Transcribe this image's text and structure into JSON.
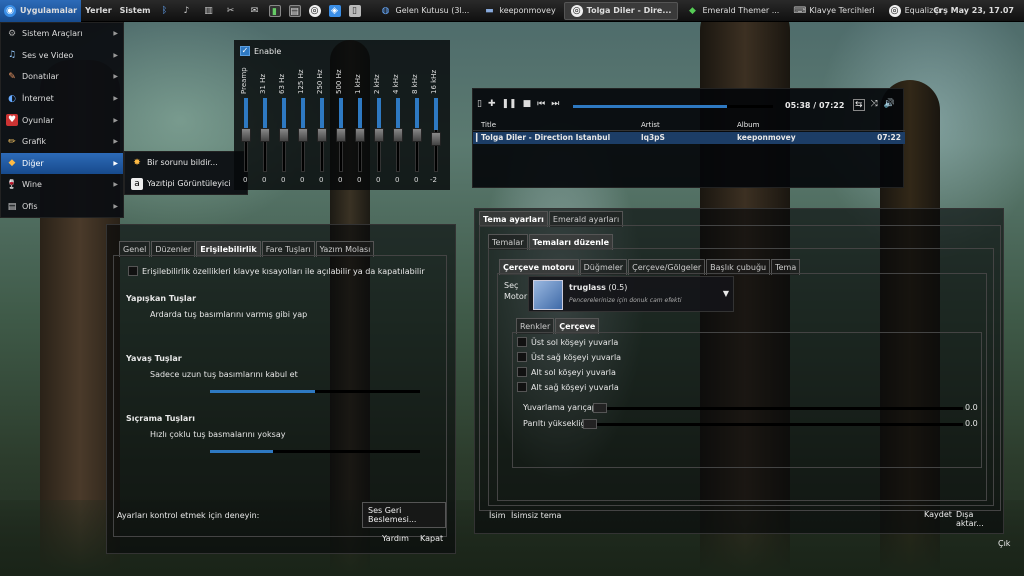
{
  "top_panel": {
    "menus": [
      "Uygulamalar",
      "Yerler",
      "Sistem"
    ],
    "tasks": [
      {
        "label": "Gelen Kutusu (3l...",
        "active": false
      },
      {
        "label": "keeponmovey",
        "active": false
      },
      {
        "label": "Tolga Diler - Dire...",
        "active": true
      },
      {
        "label": "Emerald Themer ...",
        "active": false
      },
      {
        "label": "Klavye Tercihleri",
        "active": false
      },
      {
        "label": "Equalizer",
        "active": false
      }
    ],
    "clock": "Çrş May 23, 17.07"
  },
  "app_menu": {
    "items": [
      {
        "label": "Sistem Araçları",
        "icon": "tools-icon"
      },
      {
        "label": "Ses ve Video",
        "icon": "media-icon"
      },
      {
        "label": "Donatılar",
        "icon": "accessories-icon"
      },
      {
        "label": "İnternet",
        "icon": "internet-icon"
      },
      {
        "label": "Oyunlar",
        "icon": "games-icon"
      },
      {
        "label": "Grafik",
        "icon": "graphics-icon"
      },
      {
        "label": "Diğer",
        "icon": "other-icon"
      },
      {
        "label": "Wine",
        "icon": "wine-icon"
      },
      {
        "label": "Ofis",
        "icon": "office-icon"
      }
    ],
    "highlighted_index": 6,
    "submenu": [
      "Bir sorunu bildir...",
      "Yazıtipi Görüntüleyici"
    ]
  },
  "equalizer": {
    "enable_label": "Enable",
    "enabled": true,
    "bands": [
      {
        "label": "Preamp",
        "value": "0"
      },
      {
        "label": "31 Hz",
        "value": "0"
      },
      {
        "label": "63 Hz",
        "value": "0"
      },
      {
        "label": "125 Hz",
        "value": "0"
      },
      {
        "label": "250 Hz",
        "value": "0"
      },
      {
        "label": "500 Hz",
        "value": "0"
      },
      {
        "label": "1 kHz",
        "value": "0"
      },
      {
        "label": "2 kHz",
        "value": "0"
      },
      {
        "label": "4 kHz",
        "value": "0"
      },
      {
        "label": "8 kHz",
        "value": "0"
      },
      {
        "label": "16 kHz",
        "value": "-2"
      }
    ]
  },
  "keyboard_prefs": {
    "tabs": [
      "Genel",
      "Düzenler",
      "Erişilebilirlik",
      "Fare Tuşları",
      "Yazım Molası"
    ],
    "selected_tab": 2,
    "access_checkbox": "Erişilebilirlik özellikleri klavye kısayolları ile açılabilir ya da kapatılabilir",
    "sticky_heading": "Yapışkan Tuşlar",
    "sticky_desc": "Ardarda tuş basımlarını varmış gibi yap",
    "slow_heading": "Yavaş Tuşlar",
    "slow_desc": "Sadece uzun tuş basımlarını kabul et",
    "slow_slider_value": 0.5,
    "bounce_heading": "Sıçrama Tuşları",
    "bounce_desc": "Hızlı çoklu tuş basmalarını yoksay",
    "bounce_slider_value": 0.3,
    "audio_feedback_button": "Ses Geri Beslemesi...",
    "test_label": "Ayarları kontrol etmek için deneyin:",
    "help_button": "Yardım",
    "close_button": "Kapat"
  },
  "player": {
    "time": "05:38 / 07:22",
    "progress": 0.77,
    "columns": [
      "Title",
      "Artist",
      "Album"
    ],
    "track": {
      "title": "Tolga Diler - Direction Istanbul",
      "artist": "lq3pS",
      "album": "keeponmovey",
      "length": "07:22"
    }
  },
  "emerald": {
    "outer_tabs": [
      "Tema ayarları",
      "Emerald ayarları"
    ],
    "inner_tabs": [
      "Temalar",
      "Temaları düzenle"
    ],
    "sub_tabs": [
      "Çerçeve motoru",
      "Düğmeler",
      "Çerçeve/Gölgeler",
      "Başlık çubuğu",
      "Tema"
    ],
    "engine_label": "Seç\nMotor",
    "engine_name": "truglass",
    "engine_version": "(0.5)",
    "engine_desc": "Pencerelerinize için donuk cam efekti",
    "small_tabs": [
      "Renkler",
      "Çerçeve"
    ],
    "options": [
      "Üst sol köşeyi yuvarla",
      "Üst sağ köşeyi yuvarla",
      "Alt sol köşeyi yuvarla",
      "Alt sağ köşeyi yuvarla"
    ],
    "radius_label": "Yuvarlama yarıçapı",
    "radius_value": "0.0",
    "glow_label": "Parıltı yüksekliği",
    "glow_value": "0.0",
    "name_label": "İsim",
    "name_value": "İsimsiz tema",
    "save_button": "Kaydet",
    "export_button": "Dışa aktar...",
    "quit_button": "Çık"
  },
  "colors": {
    "accent": "#2e79c2",
    "highlight": "#1f5aa3"
  }
}
